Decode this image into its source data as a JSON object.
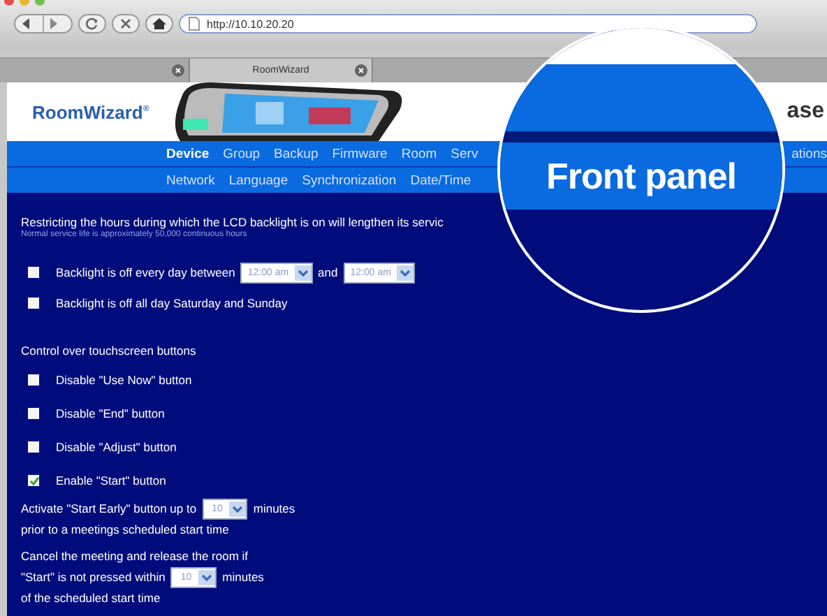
{
  "browser": {
    "address": "http://10.10.20.20",
    "tabs": [
      {
        "selected": false
      },
      {
        "label": "RoomWizard",
        "selected": true
      }
    ]
  },
  "header": {
    "logo": "RoomWizard",
    "logo_mark": "®",
    "right_text": "ase"
  },
  "nav": {
    "items": [
      {
        "label": "Device",
        "selected": true
      },
      {
        "label": "Group",
        "selected": false
      },
      {
        "label": "Backup",
        "selected": false
      },
      {
        "label": "Firmware",
        "selected": false
      },
      {
        "label": "Room",
        "selected": false
      },
      {
        "label": "Serv",
        "selected": false
      }
    ],
    "right_item": "ations"
  },
  "subnav": {
    "items": [
      {
        "label": "Network",
        "selected": false
      },
      {
        "label": "Language",
        "selected": false
      },
      {
        "label": "Synchronization",
        "selected": false
      },
      {
        "label": "Date/Time",
        "selected": false
      }
    ]
  },
  "magnifier": {
    "label": "Front panel"
  },
  "content": {
    "intro": "Restricting the hours during which the LCD backlight is on will lengthen its servic",
    "note": "Normal service life is approximately 50,000 continuous hours",
    "backlight": [
      {
        "parts": [
          "Backlight is off every day between",
          "and"
        ],
        "selects": [
          "12:00 am",
          "12:00 am"
        ],
        "checked": false
      },
      {
        "parts": [
          "Backlight is off all day Saturday and Sunday"
        ],
        "checked": false
      }
    ],
    "buttons_heading": "Control over touchscreen buttons",
    "buttons": [
      {
        "label": "Disable \"Use Now\" button",
        "checked": false
      },
      {
        "label": "Disable \"End\" button",
        "checked": false
      },
      {
        "label": "Disable \"Adjust\" button",
        "checked": false
      },
      {
        "label": "Enable \"Start\" button",
        "checked": true
      }
    ],
    "start_early": {
      "before": "Activate \"Start Early\" button up to",
      "value": "10",
      "after": "minutes",
      "line2": "prior to a meetings scheduled start time"
    },
    "cancel": {
      "line1": "Cancel the meeting and release the room if",
      "before": "\"Start\" is not pressed within",
      "value": "10",
      "after": "minutes",
      "line3": "of the scheduled start time"
    }
  }
}
